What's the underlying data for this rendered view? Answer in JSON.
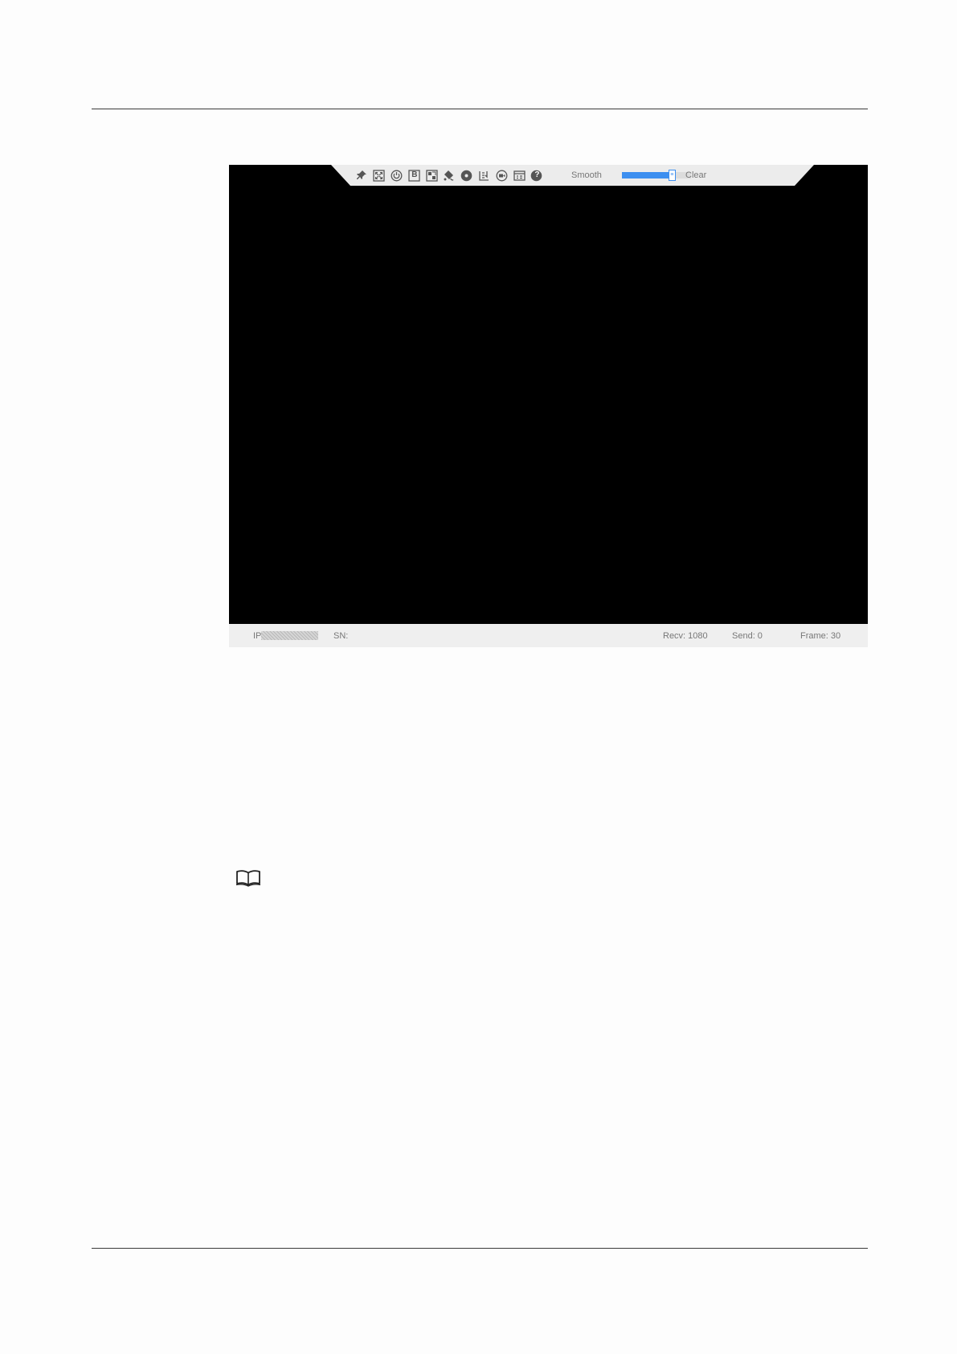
{
  "toolbar": {
    "icons": [
      "pin-icon",
      "fullscreen-icon",
      "refresh-icon",
      "b-icon",
      "layout-icon",
      "paint-icon",
      "disc-icon",
      "list-icon",
      "record-icon",
      "display-settings-icon",
      "help-icon"
    ],
    "b_label": "B",
    "help_label": "?",
    "smooth_label": "Smooth",
    "clear_label": "Clear",
    "slider_value": 0.73,
    "accent_color": "#3d8ff0"
  },
  "status": {
    "ip_label": "IP",
    "sn_label": "SN:",
    "recv": "Recv: 1080",
    "send": "Send: 0",
    "frame": "Frame: 30"
  },
  "note": {
    "icon": "book-icon"
  }
}
